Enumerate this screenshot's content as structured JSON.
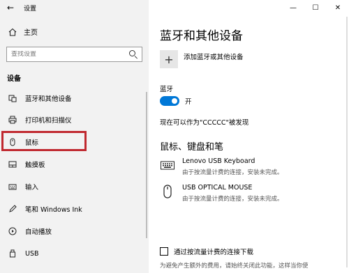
{
  "titlebar": {
    "back": "←",
    "title": "设置"
  },
  "sidebar": {
    "home": "主页",
    "search_placeholder": "查找设置",
    "section": "设备",
    "items": [
      {
        "label": "蓝牙和其他设备",
        "icon": "bluetooth-icon"
      },
      {
        "label": "打印机和扫描仪",
        "icon": "printer-icon"
      },
      {
        "label": "鼠标",
        "icon": "mouse-icon"
      },
      {
        "label": "触摸板",
        "icon": "touchpad-icon"
      },
      {
        "label": "输入",
        "icon": "keyboard-icon"
      },
      {
        "label": "笔和 Windows Ink",
        "icon": "pen-icon"
      },
      {
        "label": "自动播放",
        "icon": "autoplay-icon"
      },
      {
        "label": "USB",
        "icon": "usb-icon"
      }
    ],
    "selected": "鼠标"
  },
  "window": {
    "minimize": "—",
    "maximize": "☐",
    "close": "✕"
  },
  "main": {
    "title": "蓝牙和其他设备",
    "add_label": "添加蓝牙或其他设备",
    "bluetooth_label": "蓝牙",
    "toggle_state": "开",
    "discoverable": "现在可以作为\"CCCCC\"被发现",
    "section_title": "鼠标、键盘和笔",
    "devices": [
      {
        "name": "Lenovo USB Keyboard",
        "status": "由于按流量计费的连接，安装未完成。",
        "icon": "keyboard-icon"
      },
      {
        "name": "USB OPTICAL MOUSE",
        "status": "由于按流量计费的连接，安装未完成。",
        "icon": "mouse-icon"
      }
    ],
    "metered_label": "通过按流量计费的连接下载",
    "footnote": "为避免产生额外的费用，请始终关闭此功能，这样当你使"
  },
  "colors": {
    "accent": "#0078d7",
    "highlight": "#c0282f"
  }
}
